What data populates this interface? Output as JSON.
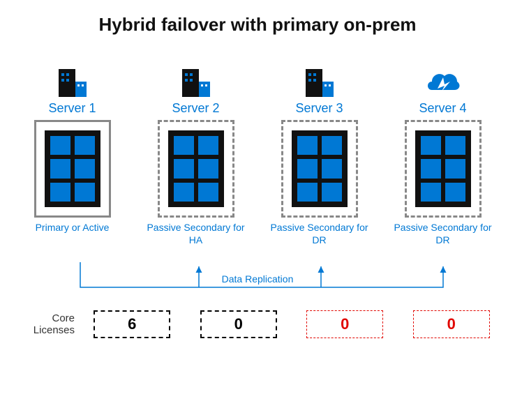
{
  "title": "Hybrid failover with primary on-prem",
  "servers": [
    {
      "name": "Server 1",
      "role": "Primary or Active",
      "iconType": "building",
      "boxStyle": "solid"
    },
    {
      "name": "Server 2",
      "role": "Passive Secondary for HA",
      "iconType": "building",
      "boxStyle": "dashed"
    },
    {
      "name": "Server 3",
      "role": "Passive Secondary for DR",
      "iconType": "building",
      "boxStyle": "dashed"
    },
    {
      "name": "Server 4",
      "role": "Passive Secondary for DR",
      "iconType": "cloud",
      "boxStyle": "dashed"
    }
  ],
  "replication_label": "Data Replication",
  "license_label_line1": "Core",
  "license_label_line2": "Licenses",
  "licenses": [
    {
      "value": "6",
      "style": "black"
    },
    {
      "value": "0",
      "style": "black"
    },
    {
      "value": "0",
      "style": "red"
    },
    {
      "value": "0",
      "style": "red"
    }
  ],
  "cores_per_server": 6,
  "colors": {
    "accent": "#0078d4",
    "black": "#111",
    "red": "#e10600"
  }
}
